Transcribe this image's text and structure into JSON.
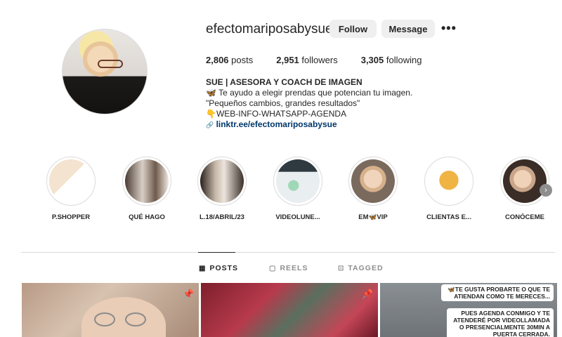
{
  "profile": {
    "username": "efectomariposabysue",
    "follow_label": "Follow",
    "message_label": "Message",
    "more_label": "•••",
    "stats": {
      "posts_count": "2,806",
      "posts_label": "posts",
      "followers_count": "2,951",
      "followers_label": "followers",
      "following_count": "3,305",
      "following_label": "following"
    },
    "bio": {
      "name": "SUE | ASESORA Y COACH DE IMAGEN",
      "line1_emoji": "🦋",
      "line1": "Te ayudo a elegir prendas que potencian tu imagen.",
      "line2": "\"Pequeños cambios, grandes resultados\"",
      "line3_emoji": "👇",
      "line3": "WEB-INFO-WHATSAPP-AGENDA",
      "link_icon": "🔗",
      "link": "linktr.ee/efectomariposabysue"
    }
  },
  "highlights": [
    {
      "label": "P.SHOPPER",
      "color": "#f3e3cf"
    },
    {
      "label": "QUÉ HAGO",
      "color": "#6f5a4c"
    },
    {
      "label": "L.18/ABRIL/23",
      "color": "#3b2f2a"
    },
    {
      "label": "VIDEOLUNE...",
      "color": "#e9eef0"
    },
    {
      "label": "EM🦋VIP",
      "color": "#d7b08c"
    },
    {
      "label": "CLIENTAS E...",
      "color": "#ffffff"
    },
    {
      "label": "CONÓCEME",
      "color": "#c9a58a"
    }
  ],
  "highlight_arrow": "›",
  "tabs": {
    "posts": {
      "icon": "▦",
      "label": "POSTS"
    },
    "reels": {
      "icon": "▢",
      "label": "REELS"
    },
    "tagged": {
      "icon": "⊡",
      "label": "TAGGED"
    }
  },
  "posts": {
    "pin_icon": "📌",
    "post3_caption1": "🦋TE GUSTA PROBARTE O QUE TE ATIENDAN COMO TE MERECES...",
    "post3_caption2": "PUES AGENDA CONMIGO Y TE ATENDERÉ POR VIDEOLLAMADA O PRESENCIALMENTE 30MIN A PUERTA CERRADA."
  },
  "colors": {
    "link": "#00376b",
    "button_bg": "#efefef",
    "divider": "#dbdbdb"
  }
}
